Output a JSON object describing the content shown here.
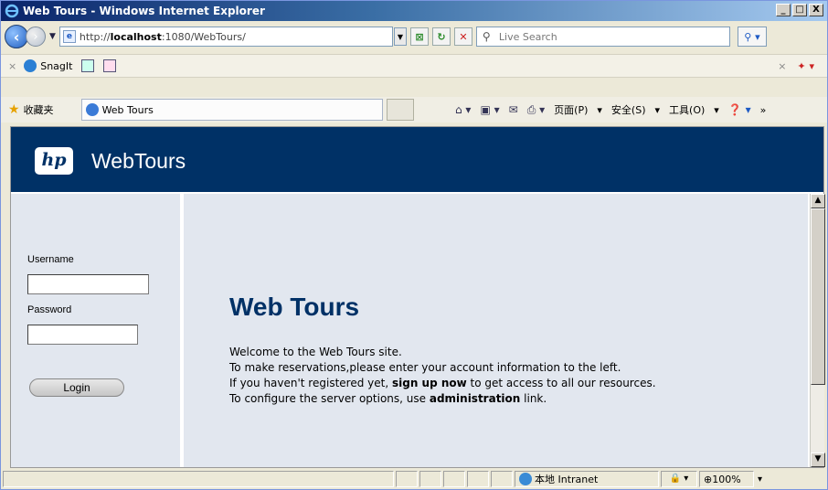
{
  "window": {
    "title": "Web Tours - Windows Internet Explorer",
    "controls": [
      "_",
      "□",
      "X"
    ]
  },
  "address": {
    "url_prefix": "http://",
    "url_host": "localhost",
    "url_suffix": ":1080/WebTours/"
  },
  "search": {
    "placeholder": "Live Search"
  },
  "snagit": {
    "label": "SnagIt"
  },
  "favorites": {
    "label": "收藏夹",
    "tab_label": "Web Tours"
  },
  "commands": {
    "page": "页面(P)",
    "safety": "安全(S)",
    "tools": "工具(O)"
  },
  "header": {
    "logo_text": "hp",
    "brand": "WebTours"
  },
  "login": {
    "username_label": "Username",
    "password_label": "Password",
    "button": "Login"
  },
  "main": {
    "heading": "Web Tours",
    "line1": "Welcome to the Web Tours site.",
    "line2": "To make reservations,please enter your account information to the left.",
    "line3_pre": "If you haven't registered yet, ",
    "line3_link": "sign up now",
    "line3_post": " to get access to all our resources.",
    "line4_pre": "To configure the server options, use ",
    "line4_link": "administration",
    "line4_post": " link."
  },
  "status": {
    "zone": "本地 Intranet",
    "zoom": "100%"
  },
  "colors": {
    "header_bg": "#003166",
    "panel_bg": "#e2e7ef",
    "heading": "#003166"
  }
}
